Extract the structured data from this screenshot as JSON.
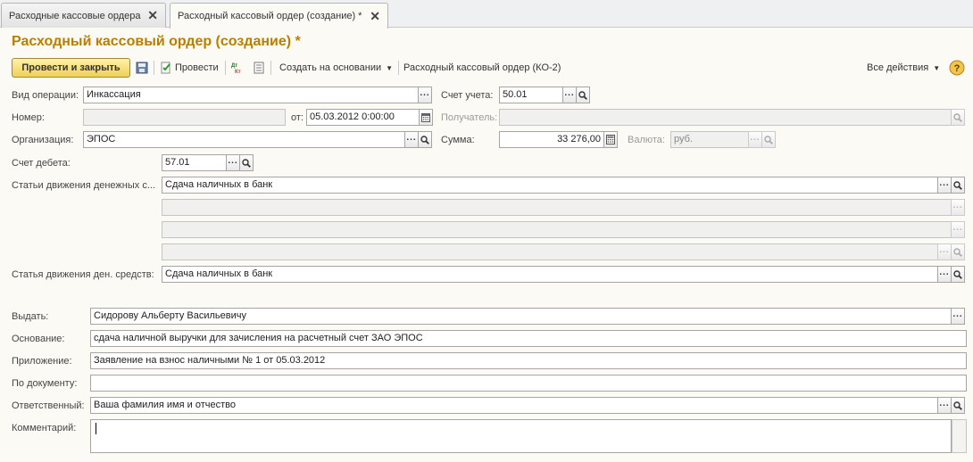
{
  "tabs": [
    {
      "label": "Расходные кассовые ордера"
    },
    {
      "label": "Расходный кассовый ордер (создание) *"
    }
  ],
  "title": "Расходный кассовый ордер (создание) *",
  "toolbar": {
    "post_close": "Провести и закрыть",
    "post": "Провести",
    "create_based": "Создать на основании",
    "print_form": "Расходный кассовый ордер (КО-2)",
    "all_actions": "Все действия",
    "dt_kt": "Дт Кт",
    "help": "?"
  },
  "form": {
    "vid_operacii": {
      "label": "Вид операции:",
      "value": "Инкассация"
    },
    "nomer": {
      "label": "Номер:",
      "value": ""
    },
    "ot": {
      "label": "от:",
      "value": "05.03.2012  0:00:00"
    },
    "organizaciya": {
      "label": "Организация:",
      "value": "ЭПОС"
    },
    "schet_debeta": {
      "label": "Счет дебета:",
      "value": "57.01"
    },
    "stati_dvizheniya": {
      "label": "Статьи движения денежных с...",
      "rows": [
        "Сдача наличных в банк",
        "",
        "",
        ""
      ]
    },
    "statya_dvizheniya": {
      "label": "Статья движения ден. средств:",
      "value": "Сдача наличных в банк"
    },
    "schet_ucheta": {
      "label": "Счет учета:",
      "value": "50.01"
    },
    "poluchatel": {
      "label": "Получатель:",
      "value": ""
    },
    "summa": {
      "label": "Сумма:",
      "value": "33 276,00"
    },
    "valyuta": {
      "label": "Валюта:",
      "value": "руб."
    },
    "vydat": {
      "label": "Выдать:",
      "value": "Сидорову Альберту Васильевичу"
    },
    "osnovanie": {
      "label": "Основание:",
      "value": "сдача наличной выручки для зачисления на расчетный счет ЗАО ЭПОС"
    },
    "prilozhenie": {
      "label": "Приложение:",
      "value": "Заявление на взнос наличными № 1 от 05.03.2012"
    },
    "po_dokumentu": {
      "label": "По документу:",
      "value": ""
    },
    "otvetstvennyi": {
      "label": "Ответственный:",
      "value": "Ваша фамилия имя и отчество"
    },
    "kommentarii": {
      "label": "Комментарий:",
      "value": ""
    }
  },
  "colors": {
    "title": "#b87f00",
    "primary_button": "#f0cf57",
    "background": "#fbfaf4"
  },
  "icons": [
    "close-icon",
    "save-icon",
    "post-icon",
    "dt-kt-icon",
    "report-icon",
    "chevron-down-icon",
    "help-icon",
    "ellipsis-icon",
    "search-icon",
    "calendar-icon",
    "calculator-icon"
  ]
}
